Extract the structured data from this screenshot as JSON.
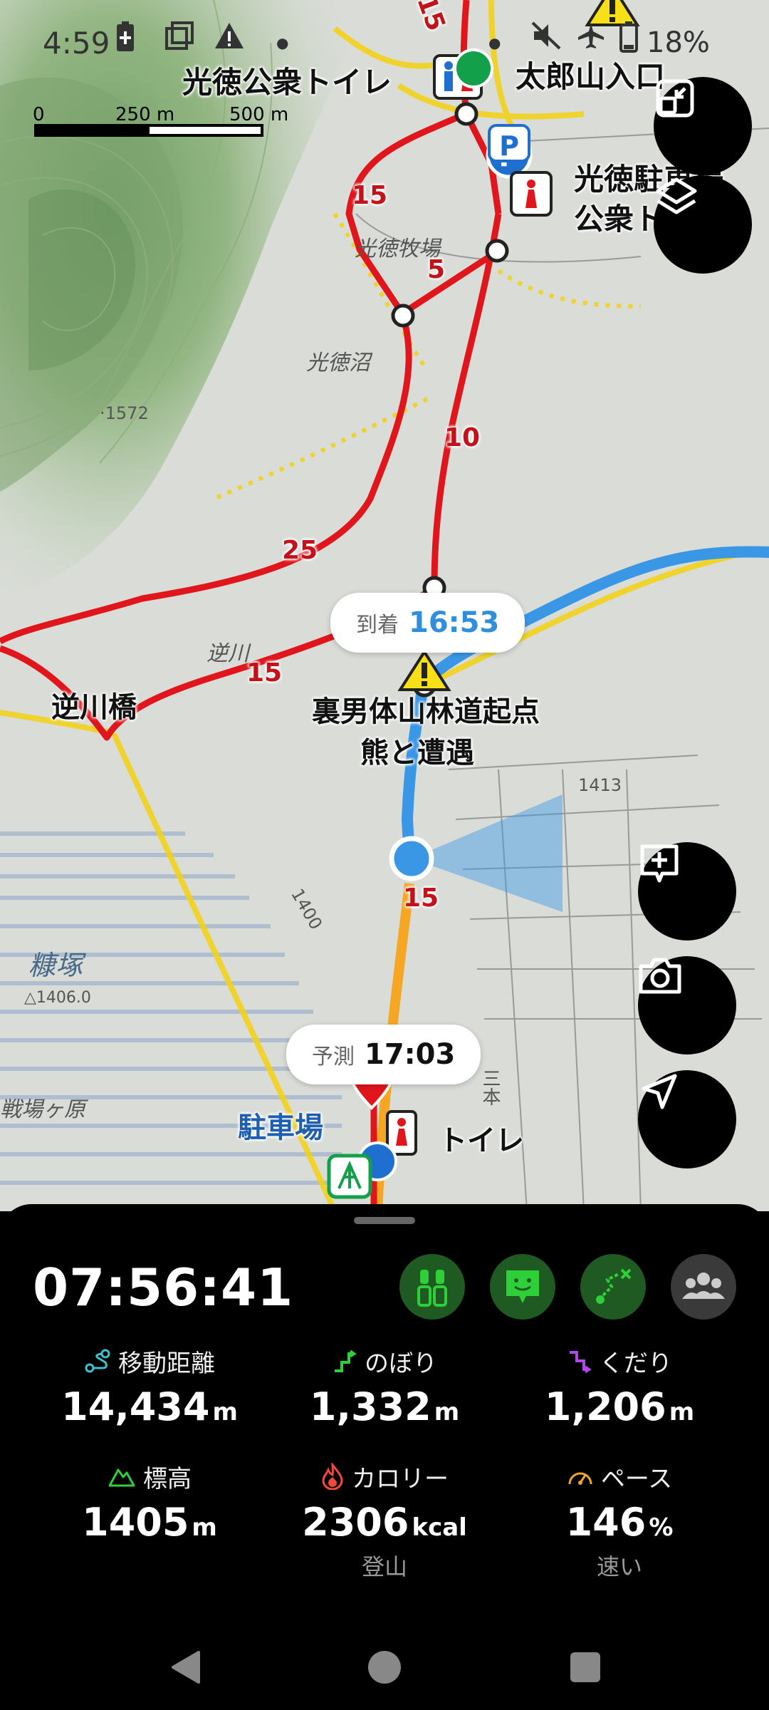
{
  "status_bar": {
    "time": "4:59",
    "battery": "18%"
  },
  "map": {
    "scale_bar": {
      "zero": "0",
      "mid": "250 m",
      "end": "500 m"
    },
    "labels": {
      "toilet_top": "光徳公衆トイレ",
      "taroyama": "太郎山入口",
      "parking_line1": "光徳駐車場",
      "parking_line2": "公衆ト",
      "koutoku_farm": "光徳牧場",
      "koutoku_numa": "光徳沼",
      "sakasagawa": "逆川",
      "sakasagawa_bridge": "逆川橋",
      "trailhead": "裏男体山林道起点",
      "bear": "熊と遭遇",
      "nukazuka": "糠塚",
      "senjogahara": "戦場ヶ原",
      "parking_bottom": "駐車場",
      "toilet_bottom": "トイレ",
      "elev_1572": "·1572",
      "elev_1413": "1413",
      "elev_1406": "△1406.0",
      "elev_1400": "1400",
      "sanbon": "三本"
    },
    "route_numbers": [
      "15",
      "15",
      "5",
      "10",
      "25",
      "15",
      "15"
    ]
  },
  "bubbles": {
    "arrival": {
      "label": "到着",
      "time": "16:53"
    },
    "forecast": {
      "label": "予測",
      "time": "17:03"
    }
  },
  "panel": {
    "elapsed": "07:56:41",
    "stats": [
      {
        "icon": "distance-icon",
        "label": "移動距離",
        "value": "14,434",
        "unit": "m",
        "sub": ""
      },
      {
        "icon": "ascent-icon",
        "label": "のぼり",
        "value": "1,332",
        "unit": "m",
        "sub": ""
      },
      {
        "icon": "descent-icon",
        "label": "くだり",
        "value": "1,206",
        "unit": "m",
        "sub": ""
      },
      {
        "icon": "elevation-icon",
        "label": "標高",
        "value": "1405",
        "unit": "m",
        "sub": ""
      },
      {
        "icon": "calorie-icon",
        "label": "カロリー",
        "value": "2306",
        "unit": "kcal",
        "sub": "登山"
      },
      {
        "icon": "pace-icon",
        "label": "ペース",
        "value": "146",
        "unit": "%",
        "sub": "速い"
      }
    ],
    "colors": {
      "green": "#2fcf3a",
      "green_bg": "#1f5a22",
      "grey_bg": "#3a3a3a",
      "route_red": "#e0161c",
      "track_blue": "#3a97e6"
    }
  }
}
